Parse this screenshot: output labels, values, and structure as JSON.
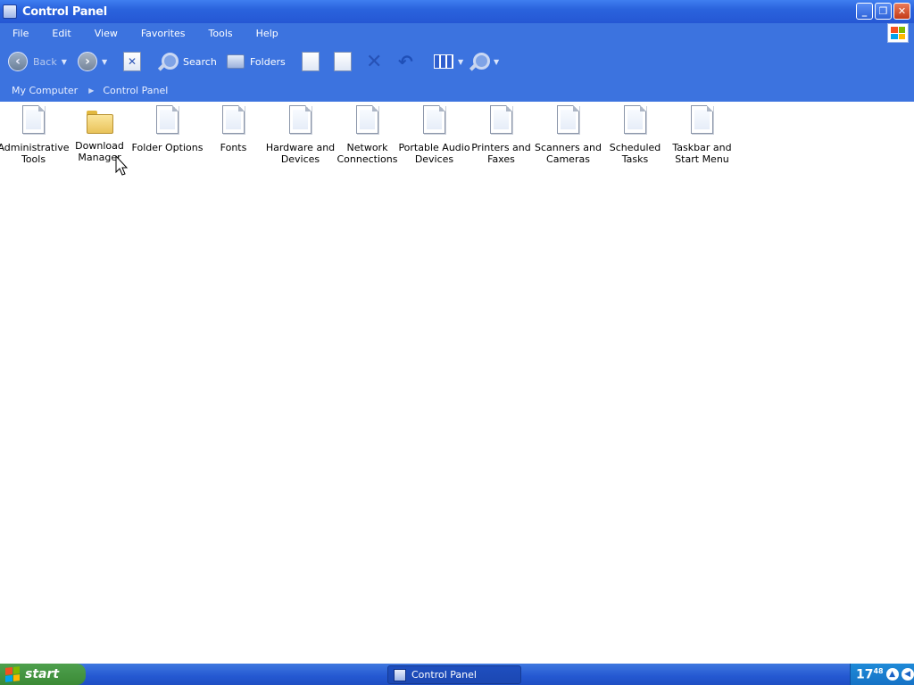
{
  "window": {
    "title": "Control Panel"
  },
  "menu": [
    "File",
    "Edit",
    "View",
    "Favorites",
    "Tools",
    "Help"
  ],
  "toolbar": {
    "back_label": "Back",
    "search_label": "Search",
    "folders_label": "Folders"
  },
  "address": {
    "crumbs": [
      "My Computer",
      "Control Panel"
    ]
  },
  "items": [
    {
      "label": "Administrative\nTools",
      "icon": "document-icon"
    },
    {
      "label": "Download\nManager",
      "icon": "folder-icon"
    },
    {
      "label": "Folder Options",
      "icon": "document-icon"
    },
    {
      "label": "Fonts",
      "icon": "document-icon"
    },
    {
      "label": "Hardware and\nDevices",
      "icon": "document-icon"
    },
    {
      "label": "Network\nConnections",
      "icon": "document-icon"
    },
    {
      "label": "Portable Audio\nDevices",
      "icon": "document-icon"
    },
    {
      "label": "Printers and\nFaxes",
      "icon": "document-icon"
    },
    {
      "label": "Scanners and\nCameras",
      "icon": "document-icon"
    },
    {
      "label": "Scheduled\nTasks",
      "icon": "document-icon"
    },
    {
      "label": "Taskbar and\nStart Menu",
      "icon": "document-icon"
    }
  ],
  "taskbar": {
    "start_label": "start",
    "task_label": "Control Panel",
    "clock_hour": "17",
    "clock_min": "48"
  }
}
